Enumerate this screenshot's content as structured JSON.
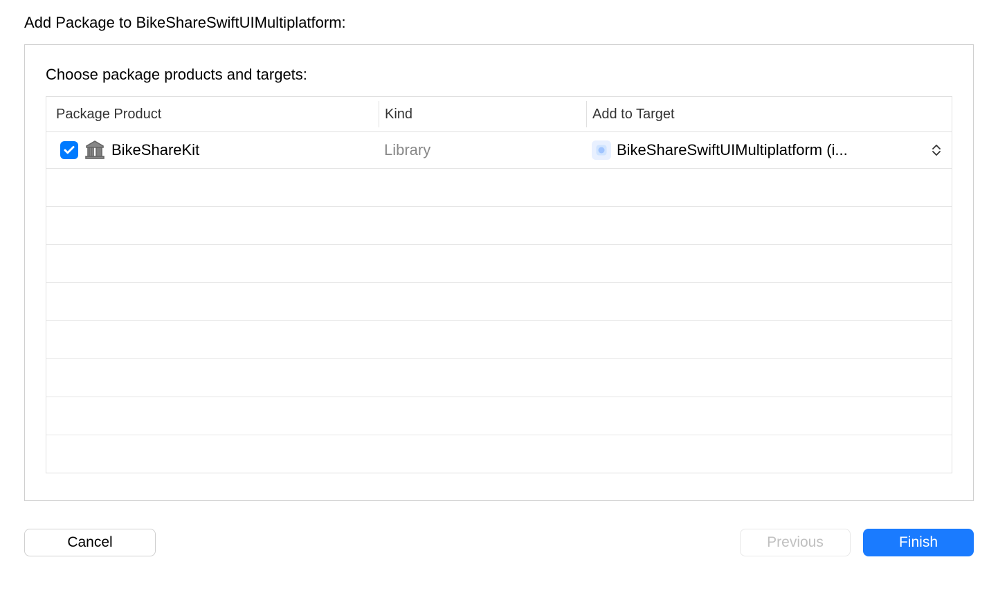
{
  "dialog": {
    "title": "Add Package to BikeShareSwiftUIMultiplatform:",
    "subtitle": "Choose package products and targets:"
  },
  "table": {
    "headers": {
      "product": "Package Product",
      "kind": "Kind",
      "target": "Add to Target"
    },
    "rows": [
      {
        "checked": true,
        "product_name": "BikeShareKit",
        "kind": "Library",
        "target": "BikeShareSwiftUIMultiplatform (i..."
      }
    ]
  },
  "buttons": {
    "cancel": "Cancel",
    "previous": "Previous",
    "finish": "Finish"
  }
}
